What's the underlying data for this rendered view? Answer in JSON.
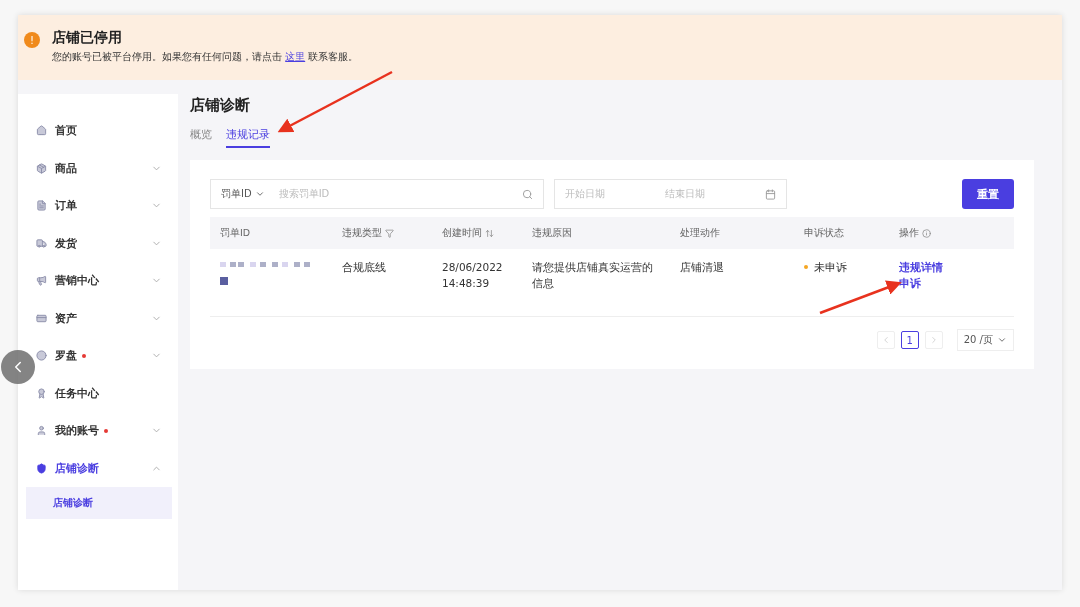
{
  "banner": {
    "icon": "!",
    "title": "店铺已停用",
    "message": "您的账号已被平台停用。如果您有任何问题，请点击 ",
    "link": "这里",
    "message_end": "联系客服。"
  },
  "sidebar": {
    "items": [
      {
        "label": "首页"
      },
      {
        "label": "商品",
        "expanded": false
      },
      {
        "label": "订单",
        "expanded": false
      },
      {
        "label": "发货",
        "expanded": false
      },
      {
        "label": "营销中心",
        "expanded": false
      },
      {
        "label": "资产",
        "expanded": false
      },
      {
        "label": "罗盘",
        "dot": true,
        "expanded": false
      },
      {
        "label": "任务中心"
      },
      {
        "label": "我的账号",
        "dot": true,
        "expanded": false
      },
      {
        "label": "店铺诊断",
        "selected": true,
        "expanded": true,
        "children": [
          {
            "label": "店铺诊断",
            "selected": true
          }
        ]
      }
    ]
  },
  "page": {
    "title": "店铺诊断",
    "tabs": [
      {
        "label": "概览",
        "selected": false
      },
      {
        "label": "违规记录",
        "selected": true
      }
    ]
  },
  "filters": {
    "search_type": "罚单ID",
    "search_placeholder": "搜索罚单ID",
    "start_placeholder": "开始日期",
    "end_placeholder": "结束日期",
    "reset": "重置"
  },
  "table": {
    "columns": [
      {
        "label": "罚单ID"
      },
      {
        "label": "违规类型",
        "kind": "filter"
      },
      {
        "label": "创建时间",
        "kind": "sort"
      },
      {
        "label": "违规原因"
      },
      {
        "label": "处理动作"
      },
      {
        "label": "申诉状态"
      },
      {
        "label": "操作",
        "kind": "info"
      }
    ],
    "rows": [
      {
        "type": "合规底线",
        "created": [
          "28/06/2022",
          "14:48:39"
        ],
        "reason": "请您提供店铺真实运营的信息",
        "action": "店铺清退",
        "status": {
          "label": "未申诉",
          "color": "#f5a623"
        },
        "links": [
          "违规详情",
          "申诉"
        ]
      }
    ]
  },
  "pagination": {
    "pages": [
      {
        "label": "1",
        "selected": true
      }
    ],
    "page_size": "20 /页"
  }
}
